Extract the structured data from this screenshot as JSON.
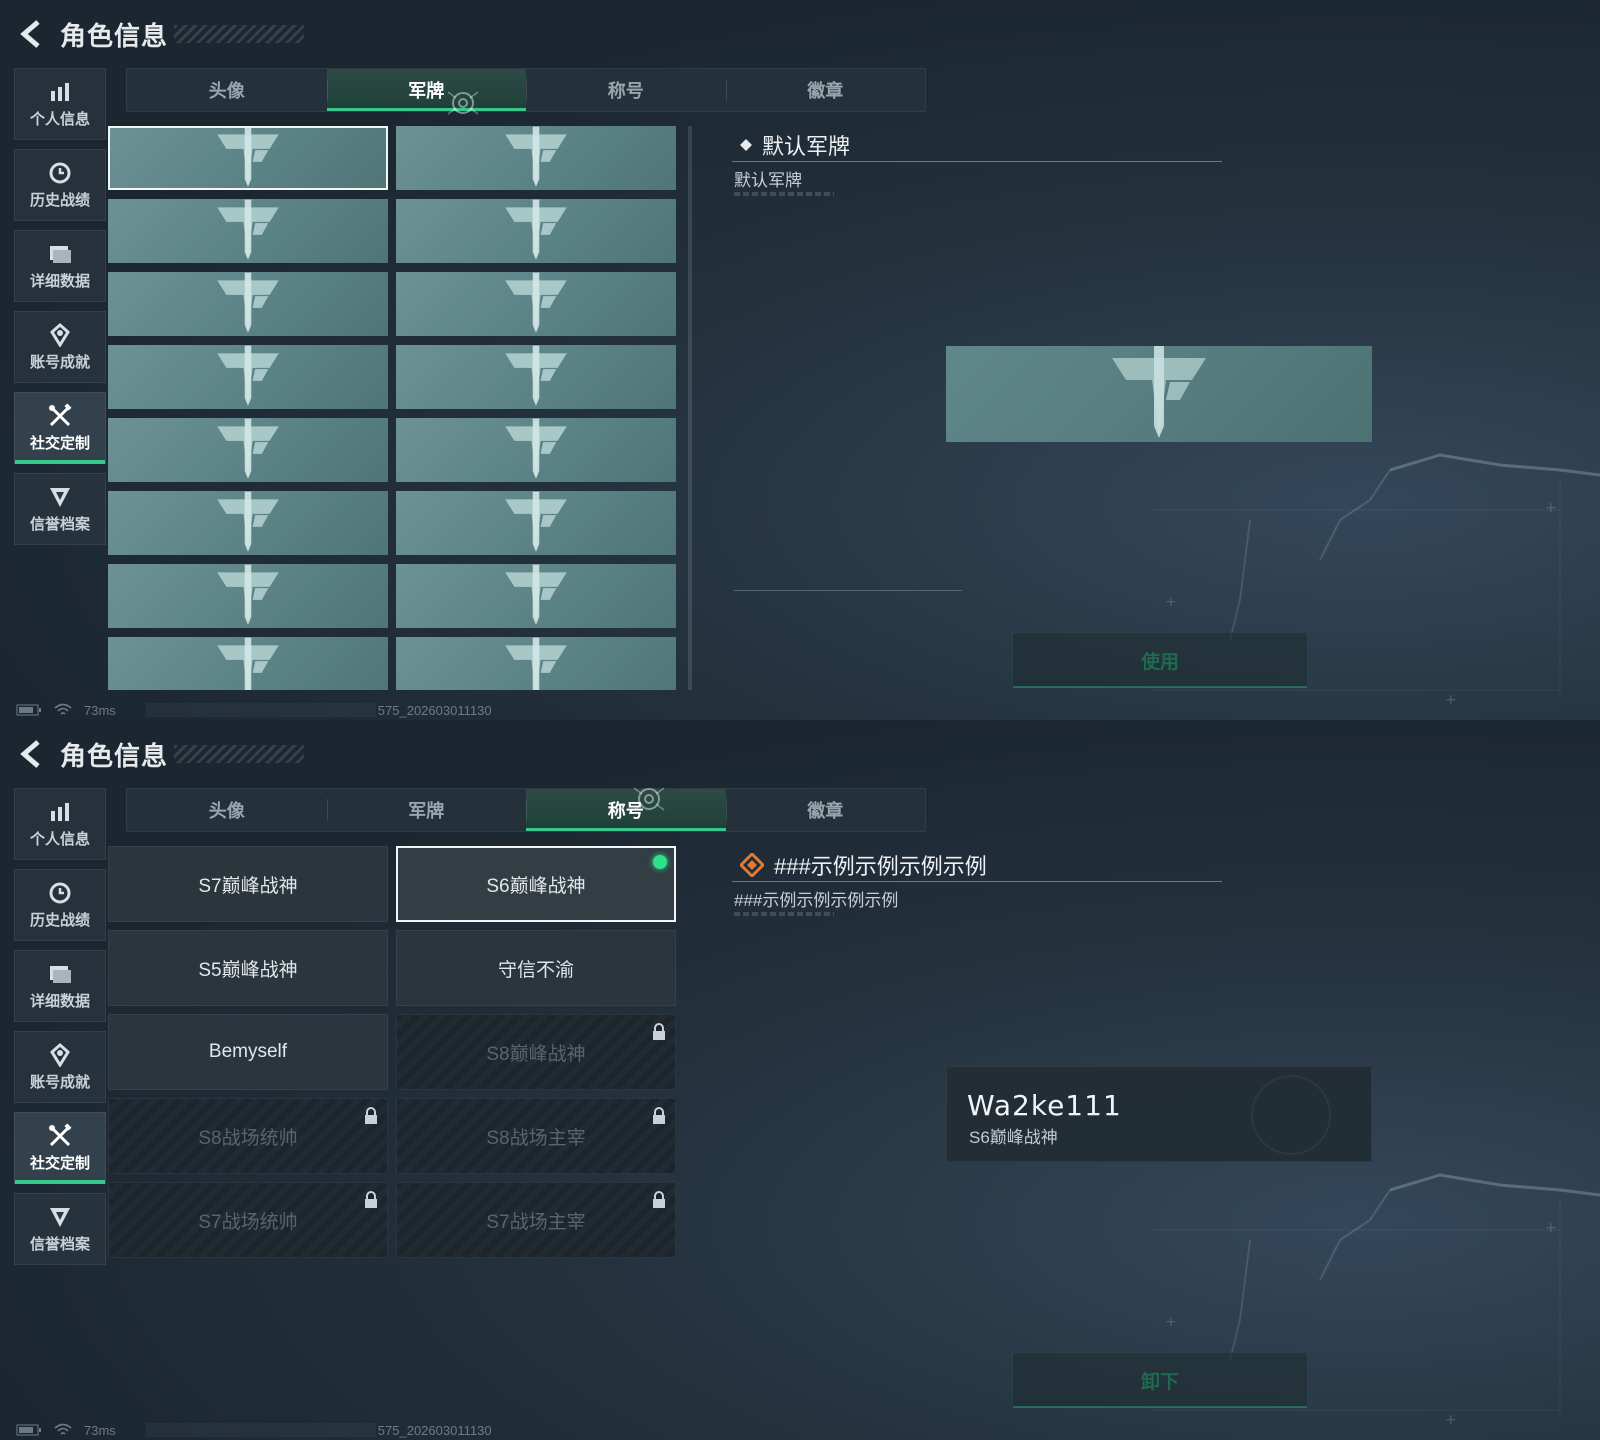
{
  "header": {
    "title": "角色信息"
  },
  "sidebar": {
    "items": [
      {
        "label": "个人信息",
        "icon": "bar-chart-icon"
      },
      {
        "label": "历史战绩",
        "icon": "clock-icon"
      },
      {
        "label": "详细数据",
        "icon": "folder-icon"
      },
      {
        "label": "账号成就",
        "icon": "achievement-icon"
      },
      {
        "label": "社交定制",
        "icon": "tools-icon",
        "active": true
      },
      {
        "label": "信誉档案",
        "icon": "shield-icon"
      }
    ]
  },
  "tabs": [
    "头像",
    "军牌",
    "称号",
    "徽章"
  ],
  "top_screen": {
    "active_tab": "军牌",
    "detail": {
      "name": "默认军牌",
      "description": "默认军牌"
    },
    "action_label": "使用",
    "dogtag_count": 16
  },
  "bottom_screen": {
    "active_tab": "称号",
    "titles": [
      {
        "label": "S7巅峰战神",
        "locked": false
      },
      {
        "label": "S6巅峰战神",
        "locked": false,
        "selected": true,
        "equipped": true
      },
      {
        "label": "S5巅峰战神",
        "locked": false
      },
      {
        "label": "守信不渝",
        "locked": false
      },
      {
        "label": "Bemyself",
        "locked": false
      },
      {
        "label": "S8巅峰战神",
        "locked": true
      },
      {
        "label": "S8战场统帅",
        "locked": true
      },
      {
        "label": "S8战场主宰",
        "locked": true
      },
      {
        "label": "S7战场统帅",
        "locked": true
      },
      {
        "label": "S7战场主宰",
        "locked": true
      }
    ],
    "detail": {
      "name": "###示例示例示例示例",
      "description": "###示例示例示例示例"
    },
    "preview": {
      "player_name": "Wa2ke111",
      "title": "S6巅峰战神"
    },
    "action_label": "卸下"
  },
  "status": {
    "ping": "73ms",
    "build": "575_202603011130"
  },
  "colors": {
    "accent": "#34c98a",
    "dogtag": "#5b8285",
    "background": "#1b2630"
  }
}
